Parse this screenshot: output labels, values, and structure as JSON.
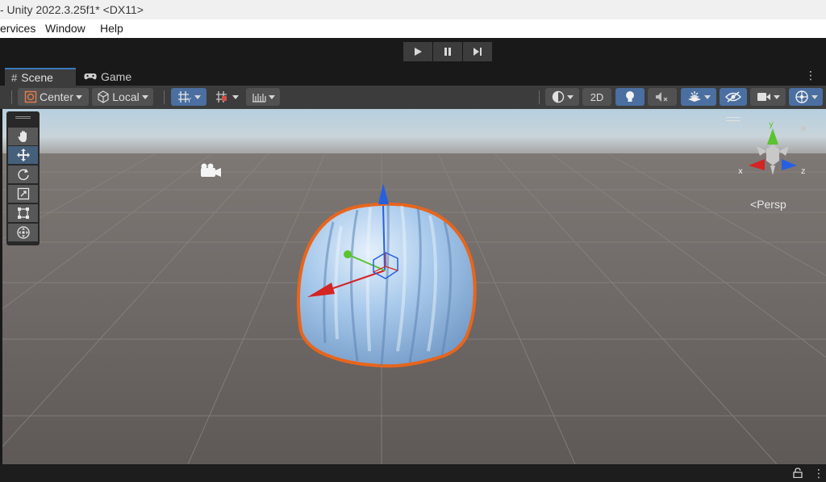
{
  "window": {
    "title": "- Unity 2022.3.25f1* <DX11>"
  },
  "menu": {
    "items": [
      "ervices",
      "Window",
      "Help"
    ]
  },
  "play_controls": {
    "play_icon": "play-icon",
    "pause_icon": "pause-icon",
    "step_icon": "step-icon"
  },
  "tabs": [
    {
      "label": "Scene",
      "icon": "grid-hash-icon",
      "active": true
    },
    {
      "label": "Game",
      "icon": "gamepad-icon",
      "active": false
    }
  ],
  "toolbar": {
    "pivot_label": "Center",
    "space_label": "Local",
    "mode_2d_label": "2D"
  },
  "tools": [
    "hand-tool",
    "move-tool",
    "rotate-tool",
    "scale-tool",
    "rect-tool",
    "transform-tool"
  ],
  "active_tool": "move-tool",
  "scene": {
    "camera_label": "Persp",
    "axis_x": "x",
    "axis_y": "y",
    "axis_z": "z"
  },
  "colors": {
    "selection_outline": "#e8651c",
    "object_fill": "#9cc3ea",
    "axis_x": "#d42424",
    "axis_y": "#5bc230",
    "axis_z": "#2660e0",
    "active_accent": "#46607c"
  }
}
